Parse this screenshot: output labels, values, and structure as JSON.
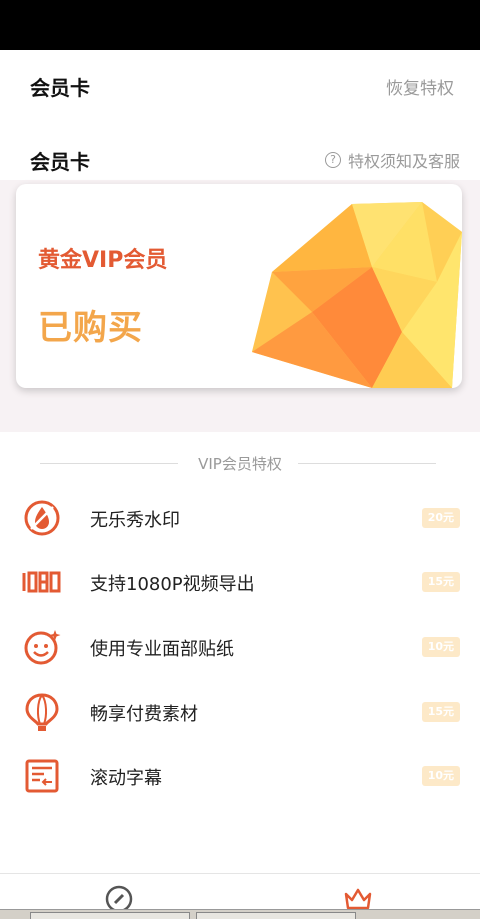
{
  "nav": {
    "title": "会员卡",
    "restore_label": "恢复特权"
  },
  "section": {
    "title": "会员卡",
    "notice_label": "特权须知及客服",
    "notice_icon": "question-icon"
  },
  "card": {
    "level": "黄金VIP会员",
    "status": "已购买"
  },
  "privileges": {
    "title": "VIP会员特权",
    "items": [
      {
        "icon": "no-watermark-icon",
        "label": "无乐秀水印",
        "price": "20元"
      },
      {
        "icon": "1080p-icon",
        "label": "支持1080P视频导出",
        "price": "15元"
      },
      {
        "icon": "face-sticker-icon",
        "label": "使用专业面部贴纸",
        "price": "10元"
      },
      {
        "icon": "balloon-icon",
        "label": "畅享付费素材",
        "price": "15元"
      },
      {
        "icon": "subtitle-icon",
        "label": "滚动字幕",
        "price": "10元"
      }
    ]
  },
  "tabbar": {
    "tabs": [
      {
        "icon": "edit-icon"
      },
      {
        "icon": "crown-icon"
      }
    ]
  },
  "colors": {
    "accent": "#e35a33",
    "gold": "#f3a64b",
    "price_badge": "#fde9c8"
  }
}
